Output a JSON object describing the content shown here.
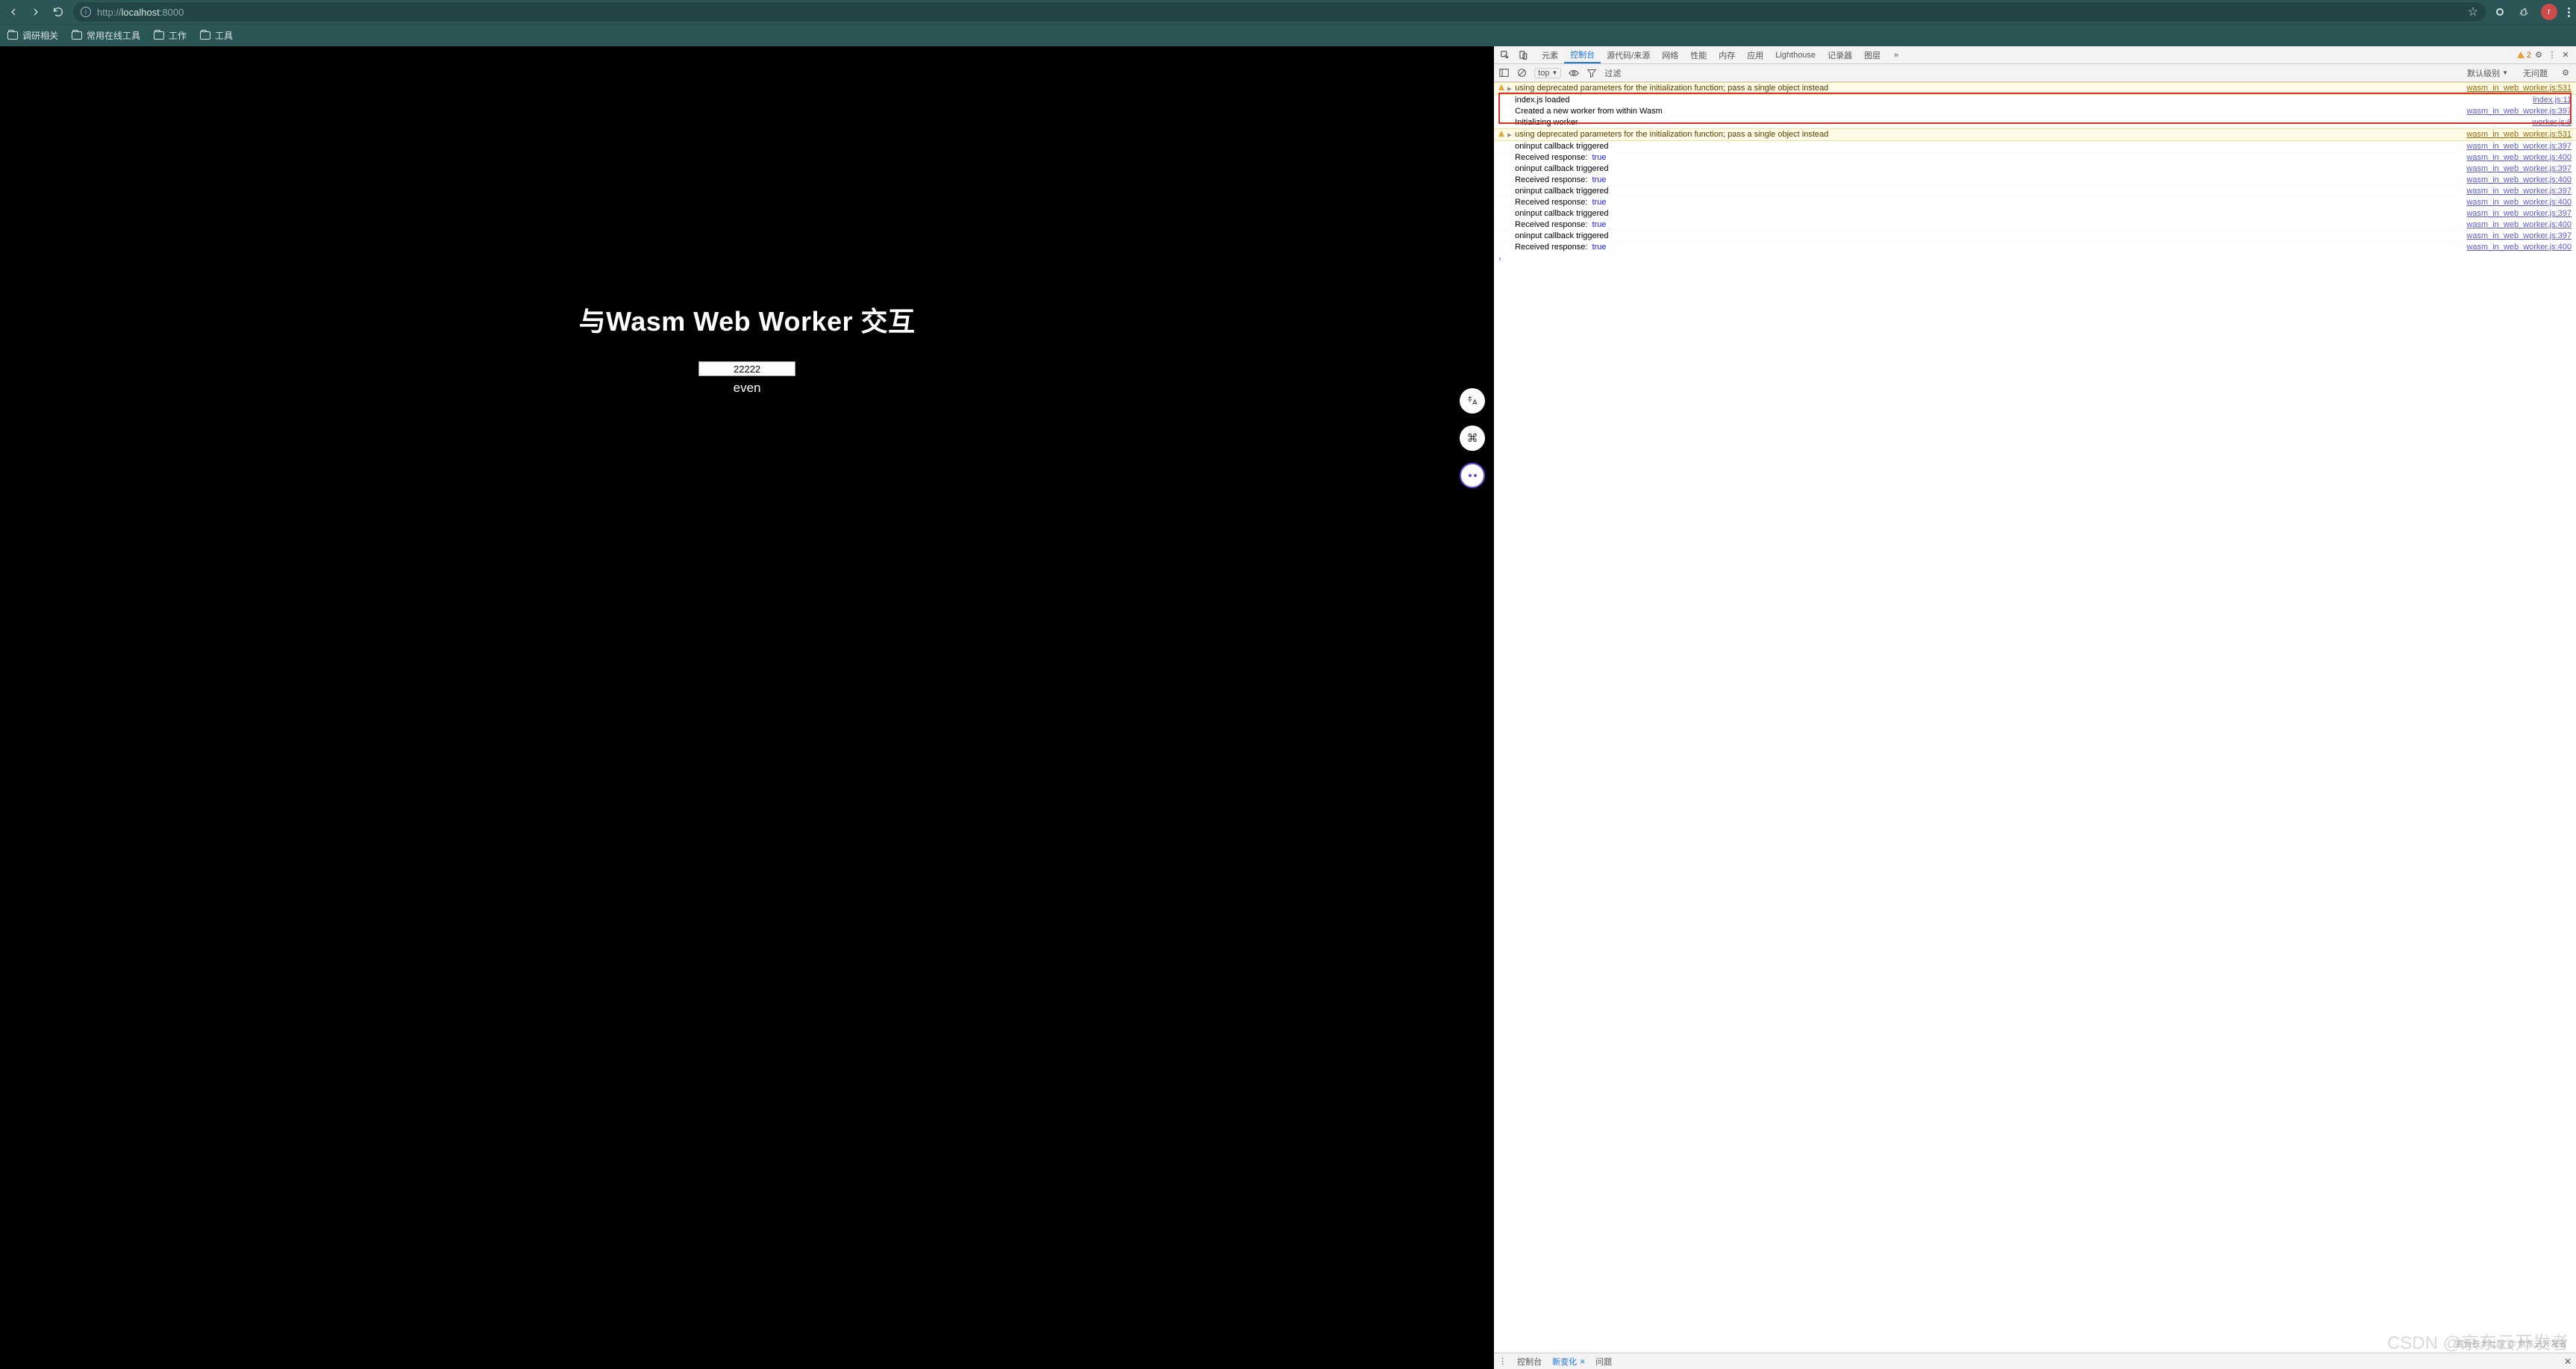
{
  "browser": {
    "url_prefix": "http://",
    "url_host": "localhost",
    "url_port": ":8000",
    "avatar_letter": "r"
  },
  "bookmarks": [
    {
      "label": "调研相关"
    },
    {
      "label": "常用在线工具"
    },
    {
      "label": "工作"
    },
    {
      "label": "工具"
    }
  ],
  "page": {
    "heading": "与Wasm Web Worker 交互",
    "input_value": "22222",
    "result": "even"
  },
  "devtools": {
    "tabs": [
      "元素",
      "控制台",
      "源代码/来源",
      "网络",
      "性能",
      "内存",
      "应用",
      "Lighthouse",
      "记录器",
      "图层"
    ],
    "active_tab": "控制台",
    "warning_count": "2",
    "filter": {
      "context": "top",
      "filter_label": "过滤",
      "level": "默认级别",
      "issues": "无问题"
    },
    "logs": [
      {
        "type": "warn",
        "msg": "using deprecated parameters for the initialization function; pass a single object instead",
        "src": "wasm_in_web_worker.js:531"
      },
      {
        "type": "log",
        "msg": "index.js loaded",
        "src": "index.js:11",
        "hl": true
      },
      {
        "type": "log",
        "msg": "Created a new worker from within Wasm",
        "src": "wasm_in_web_worker.js:397",
        "hl": true
      },
      {
        "type": "log",
        "msg": "Initializing worker",
        "src": "worker.js:6",
        "hl": true
      },
      {
        "type": "warn",
        "msg": "using deprecated parameters for the initialization function; pass a single object instead",
        "src": "wasm_in_web_worker.js:531"
      },
      {
        "type": "log",
        "msg": "oninput callback triggered",
        "src": "wasm_in_web_worker.js:397"
      },
      {
        "type": "log",
        "msg": "Received response: ",
        "bool": "true",
        "src": "wasm_in_web_worker.js:400"
      },
      {
        "type": "log",
        "msg": "oninput callback triggered",
        "src": "wasm_in_web_worker.js:397"
      },
      {
        "type": "log",
        "msg": "Received response: ",
        "bool": "true",
        "src": "wasm_in_web_worker.js:400"
      },
      {
        "type": "log",
        "msg": "oninput callback triggered",
        "src": "wasm_in_web_worker.js:397"
      },
      {
        "type": "log",
        "msg": "Received response: ",
        "bool": "true",
        "src": "wasm_in_web_worker.js:400"
      },
      {
        "type": "log",
        "msg": "oninput callback triggered",
        "src": "wasm_in_web_worker.js:397"
      },
      {
        "type": "log",
        "msg": "Received response: ",
        "bool": "true",
        "src": "wasm_in_web_worker.js:400"
      },
      {
        "type": "log",
        "msg": "oninput callback triggered",
        "src": "wasm_in_web_worker.js:397"
      },
      {
        "type": "log",
        "msg": "Received response: ",
        "bool": "true",
        "src": "wasm_in_web_worker.js:400"
      }
    ],
    "drawer_tabs": {
      "console": "控制台",
      "changes": "新变化",
      "issues": "问题"
    },
    "drawer_active": "新变化"
  },
  "watermark_main": "CSDN @京东云开发者",
  "watermark_small": "掘金技术社区 @ 京东云开发者"
}
